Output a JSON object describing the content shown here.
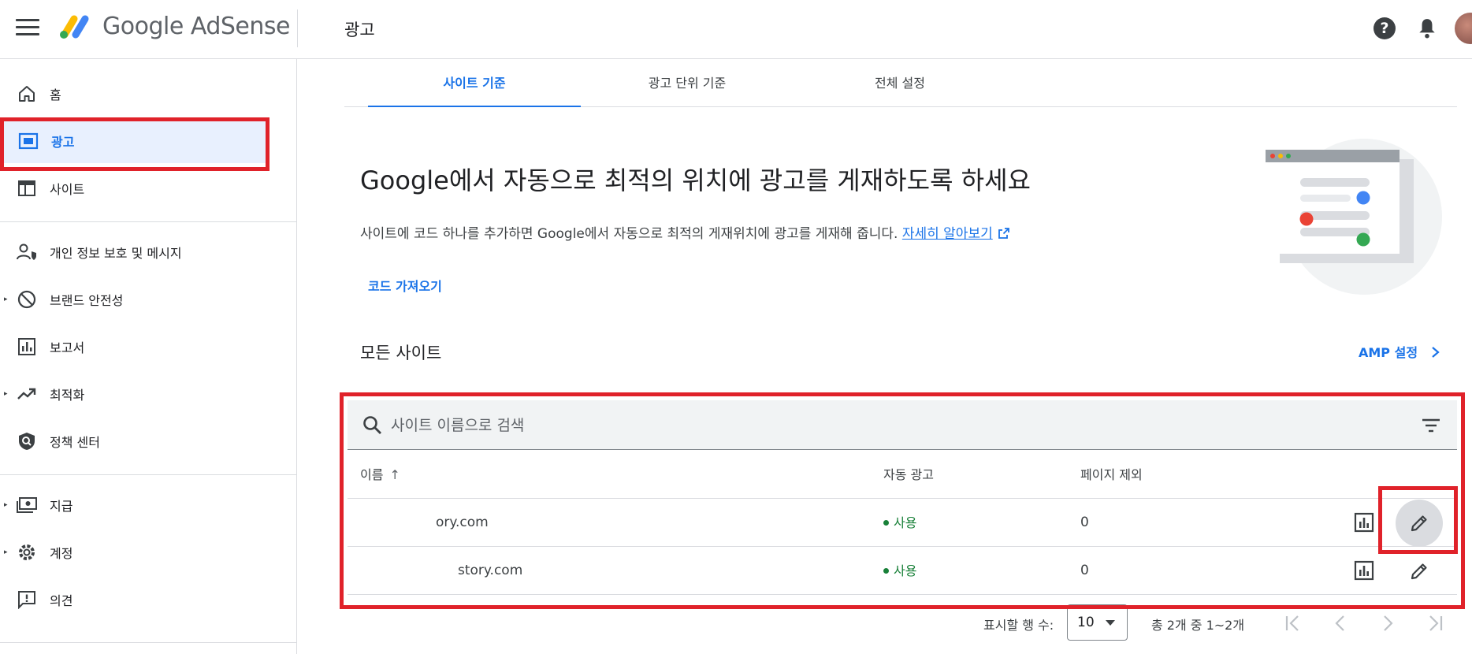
{
  "header": {
    "brand": "Google AdSense",
    "title": "광고"
  },
  "sidebar": {
    "items": [
      {
        "label": "홈"
      },
      {
        "label": "광고"
      },
      {
        "label": "사이트"
      },
      {
        "label": "개인 정보 보호 및 메시지"
      },
      {
        "label": "브랜드 안전성"
      },
      {
        "label": "보고서"
      },
      {
        "label": "최적화"
      },
      {
        "label": "정책 센터"
      },
      {
        "label": "지급"
      },
      {
        "label": "계정"
      },
      {
        "label": "의견"
      }
    ]
  },
  "tabs": [
    {
      "label": "사이트 기준"
    },
    {
      "label": "광고 단위 기준"
    },
    {
      "label": "전체 설정"
    }
  ],
  "hero": {
    "title": "Google에서 자동으로 최적의 위치에 광고를 게재하도록 하세요",
    "description": "사이트에 코드 하나를 추가하면 Google에서 자동으로 최적의 게재위치에 광고를 게재해 줍니다.",
    "learn_more": "자세히 알아보기",
    "get_code": "코드 가져오기"
  },
  "sites": {
    "title": "모든 사이트",
    "amp_settings": "AMP 설정",
    "search_placeholder": "사이트 이름으로 검색",
    "columns": {
      "name": "이름",
      "auto_ads": "자동 광고",
      "page_exclusions": "페이지 제외"
    },
    "rows": [
      {
        "name": "ory.com",
        "auto_ads": "사용",
        "page_exclusions": "0"
      },
      {
        "name": "story.com",
        "auto_ads": "사용",
        "page_exclusions": "0"
      }
    ]
  },
  "pagination": {
    "rows_label": "표시할 행 수:",
    "rows_value": "10",
    "range": "총 2개 중 1~2개"
  },
  "colors": {
    "accent": "#1a73e8",
    "active_bg": "#e8f0fe",
    "status_green": "#188038",
    "highlight_red": "#e0222a"
  }
}
